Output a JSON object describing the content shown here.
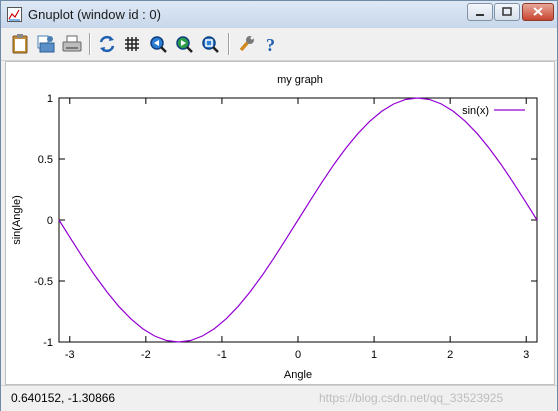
{
  "window": {
    "title": "Gnuplot (window id : 0)"
  },
  "toolbar": {
    "buttons": [
      {
        "name": "copy-to-clipboard",
        "icon": "clipboard-icon"
      },
      {
        "name": "print",
        "icon": "printer-icon"
      },
      {
        "name": "save",
        "icon": "save-icon"
      },
      {
        "name": "replot",
        "icon": "refresh-icon"
      },
      {
        "name": "toggle-grid",
        "icon": "grid-icon"
      },
      {
        "name": "zoom-previous",
        "icon": "zoom-previous-icon"
      },
      {
        "name": "zoom-next",
        "icon": "zoom-next-icon"
      },
      {
        "name": "autoscale",
        "icon": "zoom-fit-icon"
      },
      {
        "name": "options",
        "icon": "wrench-icon"
      },
      {
        "name": "help",
        "icon": "help-icon"
      }
    ]
  },
  "chart_data": {
    "type": "line",
    "title": "my graph",
    "xlabel": "Angle",
    "ylabel": "sin(Angle)",
    "xlim": [
      -3.14159,
      3.14159
    ],
    "ylim": [
      -1,
      1
    ],
    "xticks": [
      "-3",
      "-2",
      "-1",
      "0",
      "1",
      "2",
      "3"
    ],
    "xtick_values": [
      -3,
      -2,
      -1,
      0,
      1,
      2,
      3
    ],
    "yticks": [
      "-1",
      "-0.5",
      "0",
      "0.5",
      "1"
    ],
    "ytick_values": [
      -1,
      -0.5,
      0,
      0.5,
      1
    ],
    "grid": false,
    "legend_position": "top-right",
    "series": [
      {
        "name": "sin(x)",
        "color": "#9400d3",
        "x": [
          -3.1416,
          -2.9845,
          -2.8274,
          -2.6704,
          -2.5133,
          -2.3562,
          -2.1991,
          -2.042,
          -1.885,
          -1.7279,
          -1.5708,
          -1.4137,
          -1.2566,
          -1.0996,
          -0.9425,
          -0.7854,
          -0.6283,
          -0.4712,
          -0.3142,
          -0.1571,
          0.0,
          0.1571,
          0.3142,
          0.4712,
          0.6283,
          0.7854,
          0.9425,
          1.0996,
          1.2566,
          1.4137,
          1.5708,
          1.7279,
          1.885,
          2.042,
          2.1991,
          2.3562,
          2.5133,
          2.6704,
          2.8274,
          2.9845,
          3.1416
        ],
        "y": [
          0.0,
          -0.1564,
          -0.309,
          -0.454,
          -0.5878,
          -0.7071,
          -0.809,
          -0.891,
          -0.9511,
          -0.9877,
          -1.0,
          -0.9877,
          -0.9511,
          -0.891,
          -0.809,
          -0.7071,
          -0.5878,
          -0.454,
          -0.309,
          -0.1564,
          0.0,
          0.1564,
          0.309,
          0.454,
          0.5878,
          0.7071,
          0.809,
          0.891,
          0.9511,
          0.9877,
          1.0,
          0.9877,
          0.9511,
          0.891,
          0.809,
          0.7071,
          0.5878,
          0.454,
          0.309,
          0.1564,
          0.0
        ]
      }
    ]
  },
  "status": {
    "coords": "0.640152, -1.30866"
  },
  "watermark": "https://blog.csdn.net/qq_33523925"
}
